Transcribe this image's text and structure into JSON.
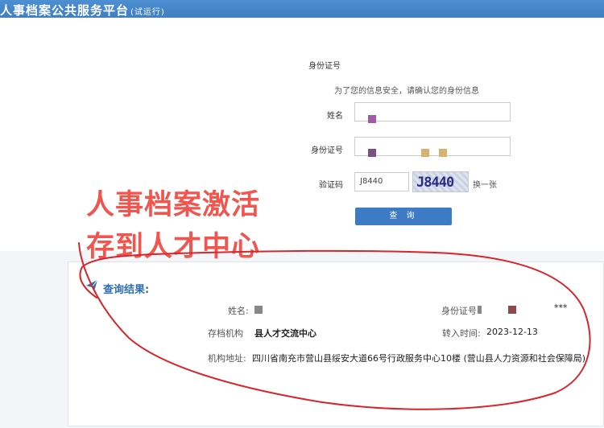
{
  "header": {
    "title": "人事档案公共服务平台",
    "badge": "(试运行)"
  },
  "form": {
    "tab_label": "身份证号",
    "hint": "为了您的信息安全，请确认您的身份信息",
    "name_label": "姓名",
    "id_label": "身份证号",
    "captcha_label": "验证码",
    "captcha_value": "J8440",
    "captcha_image_text": "J8440",
    "refresh_label": "换一张",
    "query_label": "查 询"
  },
  "overlay": {
    "line1": "人事档案激活",
    "line2": "存到人才中心"
  },
  "result": {
    "title": "查询结果:",
    "name_label": "姓名:",
    "id_label": "身份证号",
    "id_suffix": "***",
    "org_label": "存档机构",
    "org_value": "县人才交流中心",
    "transfer_label": "转入时间:",
    "transfer_value": "2023-12-13",
    "address_label": "机构地址:",
    "address_value": "四川省南充市营山县绥安大道66号行政服务中心10楼 (营山县人力资源和社会保障局)"
  },
  "colors": {
    "brand": "#3d7cc4",
    "overlay_text": "#f0564e",
    "annotation": "#d6262b"
  }
}
